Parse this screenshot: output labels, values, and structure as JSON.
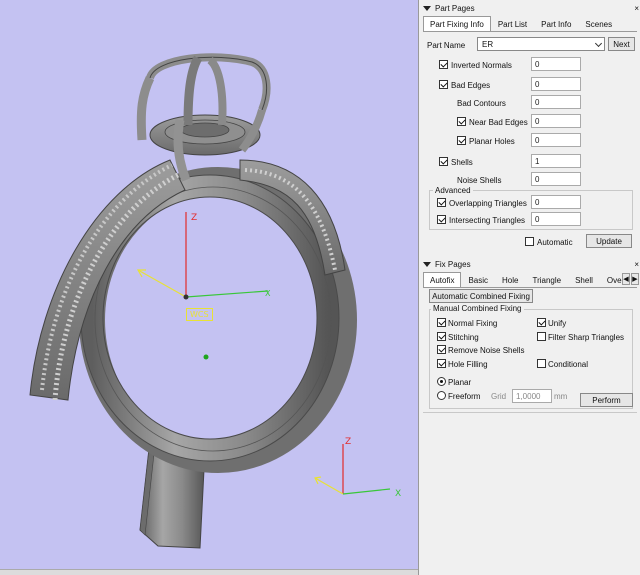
{
  "viewport": {
    "wcs_label": "WCS"
  },
  "part_pages": {
    "title": "Part Pages",
    "close": "×",
    "tabs": [
      "Part Fixing Info",
      "Part List",
      "Part Info",
      "Scenes"
    ],
    "part_name_label": "Part Name",
    "part_name_value": "ER",
    "next_label": "Next",
    "rows": [
      {
        "label": "Inverted Normals",
        "value": "0"
      },
      {
        "label": "Bad Edges",
        "value": "0"
      },
      {
        "label": "Bad Contours",
        "value": "0"
      },
      {
        "label": "Near Bad Edges",
        "value": "0"
      },
      {
        "label": "Planar Holes",
        "value": "0"
      },
      {
        "label": "Shells",
        "value": "1"
      },
      {
        "label": "Noise Shells",
        "value": "0"
      }
    ],
    "advanced_label": "Advanced",
    "advanced_rows": [
      {
        "label": "Overlapping Triangles",
        "value": "0"
      },
      {
        "label": "Intersecting Triangles",
        "value": "0"
      }
    ],
    "automatic_label": "Automatic",
    "update_label": "Update"
  },
  "fix_pages": {
    "title": "Fix Pages",
    "close": "×",
    "tabs": [
      "Autofix",
      "Basic",
      "Hole",
      "Triangle",
      "Shell",
      "Over"
    ],
    "scroll_left": "◀",
    "scroll_right": "▶",
    "auto_combined_label": "Automatic Combined Fixing",
    "manual_label": "Manual Combined Fixing",
    "options": {
      "normal_fixing": "Normal Fixing",
      "unify": "Unify",
      "stitching": "Stitching",
      "filter_sharp": "Filter Sharp Triangles",
      "remove_noise": "Remove Noise Shells",
      "hole_filling": "Hole Filling",
      "conditional": "Conditional"
    },
    "planar_label": "Planar",
    "freeform_label": "Freeform",
    "grid_label": "Grid",
    "grid_value": "1,0000",
    "grid_unit": "mm",
    "perform_label": "Perform"
  }
}
